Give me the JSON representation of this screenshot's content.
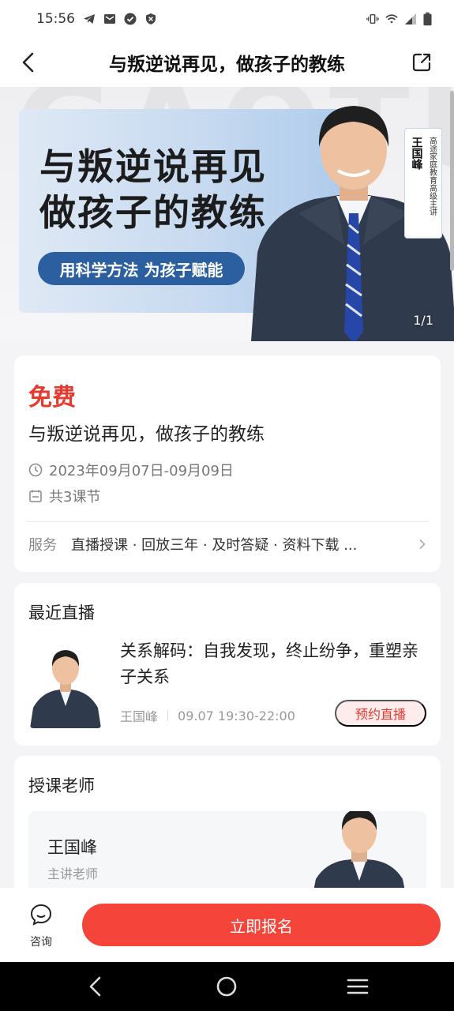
{
  "status_bar": {
    "time": "15:56"
  },
  "app_bar": {
    "title": "与叛逆说再见，做孩子的教练"
  },
  "banner": {
    "watermark": "GAOTU",
    "headline_line1": "与叛逆说再见",
    "headline_line2": "做孩子的教练",
    "tagline": "用科学方法 为孩子赋能",
    "teacher_name": "王国峰",
    "teacher_title": "高途家庭教育高级主讲",
    "counter": "1/1"
  },
  "course": {
    "price": "免费",
    "title": "与叛逆说再见，做孩子的教练",
    "date_range": "2023年09月07日-09月09日",
    "lessons": "共3课节",
    "service_label": "服务",
    "service_items": "直播授课 · 回放三年 · 及时答疑 · 资料下载 ..."
  },
  "live": {
    "section_title": "最近直播",
    "title": "关系解码：自我发现，终止纷争，重塑亲子关系",
    "teacher": "王国峰",
    "time": "09.07 19:30-22:00",
    "reserve_label": "预约直播"
  },
  "teacher": {
    "section_title": "授课老师",
    "name": "王国峰",
    "role": "主讲老师"
  },
  "action_bar": {
    "consult_label": "咨询",
    "enroll_label": "立即报名"
  },
  "colors": {
    "accent_red": "#f5453b",
    "price_red": "#e8392e",
    "tagline_blue": "#2b5fa0"
  }
}
